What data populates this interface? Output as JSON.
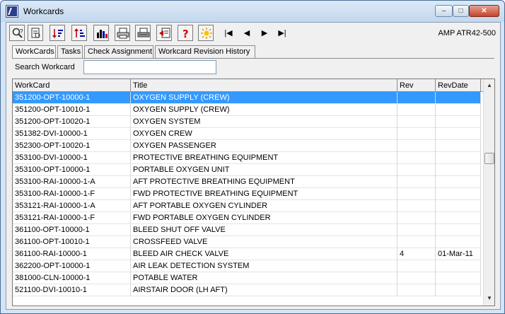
{
  "window": {
    "title": "Workcards",
    "controls": {
      "minimize": "‒",
      "maximize": "□",
      "close": "✕"
    }
  },
  "toolbar": {
    "buttons": [
      "find-icon",
      "print-preview-icon",
      "sort-ascending-icon",
      "sort-descending-icon",
      "chart-icon",
      "print-icon",
      "print-setup-icon",
      "export-icon",
      "help-icon",
      "new-icon"
    ],
    "nav": {
      "first": "|◀",
      "prev": "◀",
      "next": "▶",
      "last": "▶|"
    },
    "right_label": "AMP ATR42-500"
  },
  "tabs": [
    {
      "label": "WorkCards",
      "active": true
    },
    {
      "label": "Tasks",
      "active": false
    },
    {
      "label": "Check Assignment",
      "active": false
    },
    {
      "label": "Workcard Revision History",
      "active": false
    }
  ],
  "search": {
    "label": "Search Workcard",
    "value": ""
  },
  "grid": {
    "columns": [
      "WorkCard",
      "Title",
      "Rev",
      "RevDate"
    ],
    "rows": [
      {
        "workcard": "351200-OPT-10000-1",
        "title": "OXYGEN SUPPLY (CREW)",
        "rev": "",
        "revdate": "",
        "selected": true
      },
      {
        "workcard": "351200-OPT-10010-1",
        "title": "OXYGEN SUPPLY (CREW)",
        "rev": "",
        "revdate": ""
      },
      {
        "workcard": "351200-OPT-10020-1",
        "title": "OXYGEN SYSTEM",
        "rev": "",
        "revdate": ""
      },
      {
        "workcard": "351382-DVI-10000-1",
        "title": "OXYGEN CREW",
        "rev": "",
        "revdate": ""
      },
      {
        "workcard": "352300-OPT-10020-1",
        "title": "OXYGEN PASSENGER",
        "rev": "",
        "revdate": ""
      },
      {
        "workcard": "353100-DVI-10000-1",
        "title": "PROTECTIVE BREATHING EQUIPMENT",
        "rev": "",
        "revdate": ""
      },
      {
        "workcard": "353100-OPT-10000-1",
        "title": "PORTABLE OXYGEN UNIT",
        "rev": "",
        "revdate": ""
      },
      {
        "workcard": "353100-RAI-10000-1-A",
        "title": "AFT PROTECTIVE BREATHING EQUIPMENT",
        "rev": "",
        "revdate": ""
      },
      {
        "workcard": "353100-RAI-10000-1-F",
        "title": "FWD PROTECTIVE BREATHING EQUIPMENT",
        "rev": "",
        "revdate": ""
      },
      {
        "workcard": "353121-RAI-10000-1-A",
        "title": "AFT PORTABLE OXYGEN CYLINDER",
        "rev": "",
        "revdate": ""
      },
      {
        "workcard": "353121-RAI-10000-1-F",
        "title": "FWD PORTABLE OXYGEN CYLINDER",
        "rev": "",
        "revdate": ""
      },
      {
        "workcard": "361100-OPT-10000-1",
        "title": "BLEED SHUT OFF VALVE",
        "rev": "",
        "revdate": ""
      },
      {
        "workcard": "361100-OPT-10010-1",
        "title": "CROSSFEED VALVE",
        "rev": "",
        "revdate": ""
      },
      {
        "workcard": "361100-RAI-10000-1",
        "title": "BLEED AIR CHECK VALVE",
        "rev": "4",
        "revdate": "01-Mar-11"
      },
      {
        "workcard": "362200-OPT-10000-1",
        "title": "AIR LEAK DETECTION SYSTEM",
        "rev": "",
        "revdate": ""
      },
      {
        "workcard": "381000-CLN-10000-1",
        "title": "POTABLE WATER",
        "rev": "",
        "revdate": ""
      },
      {
        "workcard": "521100-DVI-10010-1",
        "title": "AIRSTAIR DOOR (LH AFT)",
        "rev": "",
        "revdate": ""
      }
    ]
  },
  "scrollbar": {
    "up": "▲",
    "down": "▼"
  },
  "colors": {
    "selection": "#3399ff",
    "titlebar": "#c3d8ee"
  }
}
